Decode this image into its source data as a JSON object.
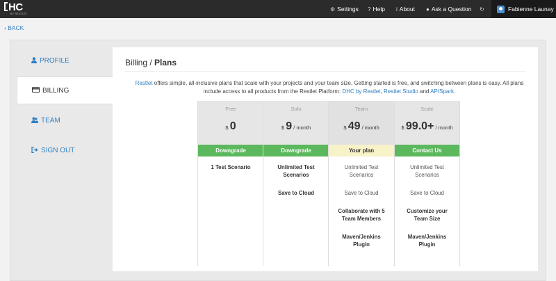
{
  "brand": {
    "logo": "HC",
    "logo_sub": "BY RESTLET"
  },
  "topnav": {
    "settings": "Settings",
    "help": "Help",
    "about": "About",
    "ask": "Ask a Question",
    "user": "Fabienne Launay"
  },
  "back": "‹ BACK",
  "sidebar": {
    "items": [
      {
        "label": "PROFILE",
        "icon": "user-icon"
      },
      {
        "label": "BILLING",
        "icon": "credit-card-icon"
      },
      {
        "label": "TEAM",
        "icon": "team-icon"
      },
      {
        "label": "SIGN OUT",
        "icon": "sign-out-icon"
      }
    ]
  },
  "page": {
    "breadcrumb": "Billing / ",
    "title": "Plans",
    "desc": {
      "restlet": "Restlet",
      "text1": " offers simple, all-inclusive plans that scale with your projects and your team size. Getting started is free, and switching between plans is easy. All plans include access to all products from the Restlet Platform: ",
      "link_dhc": "DHC by Restlet",
      "comma": ", ",
      "link_studio": "Restlet Studio",
      "and": " and ",
      "link_apispark": "APISpark",
      "period": "."
    }
  },
  "plans": [
    {
      "name": "Free",
      "currency": "$",
      "amount": "0",
      "per": "",
      "button": "Downgrade",
      "features": [
        "1 Test Scenario"
      ]
    },
    {
      "name": "Solo",
      "currency": "$",
      "amount": "9",
      "per": " / month",
      "button": "Downgrade",
      "features": [
        "Unlimited Test Scenarios",
        "Save to Cloud"
      ]
    },
    {
      "name": "Team",
      "currency": "$",
      "amount": "49",
      "per": " / month",
      "button": "Your plan",
      "features": [
        "Unlimited Test Scenarios",
        "Save to Cloud",
        "Collaborate with 5 Team Members",
        "Maven/Jenkins Plugin"
      ]
    },
    {
      "name": "Scale",
      "currency": "$",
      "amount": "99.0+",
      "per": " / month",
      "button": "Contact Us",
      "features": [
        "Unlimited Test Scenarios",
        "Save to Cloud",
        "Customize your Team Size",
        "Maven/Jenkins Plugin"
      ]
    }
  ],
  "colors": {
    "accent": "#2f7fc1",
    "button_green": "#5cb85c",
    "current_plan": "#f7f2c8",
    "topbar": "#2b2b2b"
  }
}
